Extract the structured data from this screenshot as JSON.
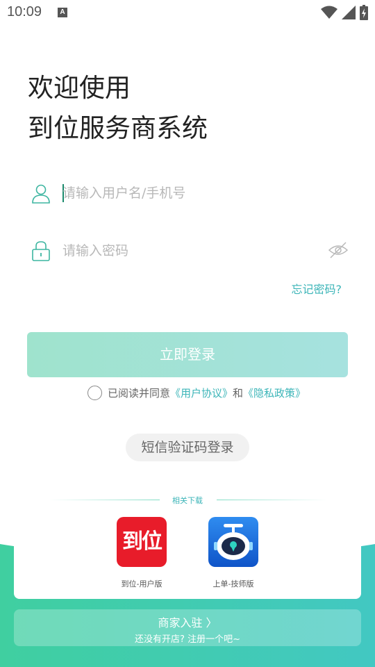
{
  "status_bar": {
    "time": "10:09",
    "notif_badge": "A"
  },
  "header": {
    "line1": "欢迎使用",
    "line2": "到位服务商系统"
  },
  "form": {
    "username_placeholder": "请输入用户名/手机号",
    "password_placeholder": "请输入密码",
    "forgot_label": "忘记密码?",
    "login_label": "立即登录"
  },
  "agreement": {
    "prefix": "已阅读并同意",
    "user_agreement": "《用户协议》",
    "and": "和",
    "privacy": "《隐私政策》"
  },
  "sms_login_label": "短信验证码登录",
  "downloads": {
    "title": "相关下载",
    "apps": [
      {
        "icon_text": "到位",
        "label": "到位-用户版"
      },
      {
        "label": "上单-技师版"
      }
    ]
  },
  "merchant": {
    "title": "商家入驻 〉",
    "subtitle": "还没有开店? 注册一个吧~"
  },
  "colors": {
    "accent": "#3cb5b8",
    "button": "#9fe3cd",
    "green": "#40cfa0"
  }
}
